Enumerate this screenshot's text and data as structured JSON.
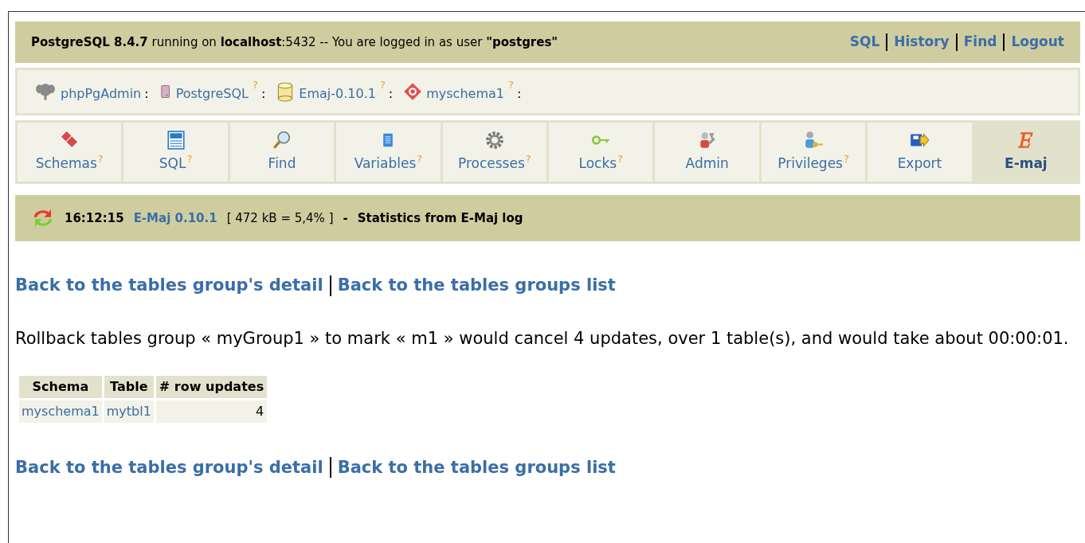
{
  "topbar": {
    "info": "**PostgreSQL 8.4.7** running on **localhost**:5432 -- You are logged in as user **\"postgres\"**",
    "links": [
      "SQL",
      "History",
      "Find",
      "Logout"
    ]
  },
  "breadcrumb": [
    {
      "kind": "elephant",
      "label": "phpPgAdmin",
      "separator": ":"
    },
    {
      "kind": "server",
      "label": "PostgreSQL",
      "help": "?",
      "separator": ":"
    },
    {
      "kind": "database",
      "label": "Emaj-0.10.1",
      "help": "?",
      "separator": ":"
    },
    {
      "kind": "schema",
      "label": "myschema1",
      "help": "?",
      "separator": ":"
    }
  ],
  "tabs": [
    {
      "kind": "schemas",
      "label": "Schemas",
      "help": "?",
      "selected": false
    },
    {
      "kind": "sql",
      "label": "SQL",
      "help": "?",
      "selected": false
    },
    {
      "kind": "find",
      "label": "Find",
      "selected": false
    },
    {
      "kind": "variables",
      "label": "Variables",
      "help": "?",
      "selected": false
    },
    {
      "kind": "processes",
      "label": "Processes",
      "help": "?",
      "selected": false
    },
    {
      "kind": "locks",
      "label": "Locks",
      "help": "?",
      "selected": false
    },
    {
      "kind": "admin",
      "label": "Admin",
      "selected": false
    },
    {
      "kind": "privileges",
      "label": "Privileges",
      "help": "?",
      "selected": false
    },
    {
      "kind": "export",
      "label": "Export",
      "selected": false
    },
    {
      "kind": "emaj",
      "label": "E-maj",
      "selected": true
    }
  ],
  "status": {
    "time": "16:12:15",
    "version": "E-Maj 0.10.1",
    "size": "[ 472 kB = 5,4% ]",
    "separator": "-",
    "title": "Statistics from E-Maj log"
  },
  "nav_links_top": [
    "Back to the tables group's detail",
    "Back to the tables groups list"
  ],
  "message": "Rollback tables group « myGroup1 » to mark « m1 » would cancel 4 updates, over 1 table(s), and would take about 00:00:01.",
  "table": {
    "columns": [
      "Schema",
      "Table",
      "# row updates"
    ],
    "rows": [
      [
        "myschema1",
        "mytbl1",
        "4"
      ]
    ]
  },
  "nav_links_bottom": [
    "Back to the tables group's detail",
    "Back to the tables groups list"
  ]
}
